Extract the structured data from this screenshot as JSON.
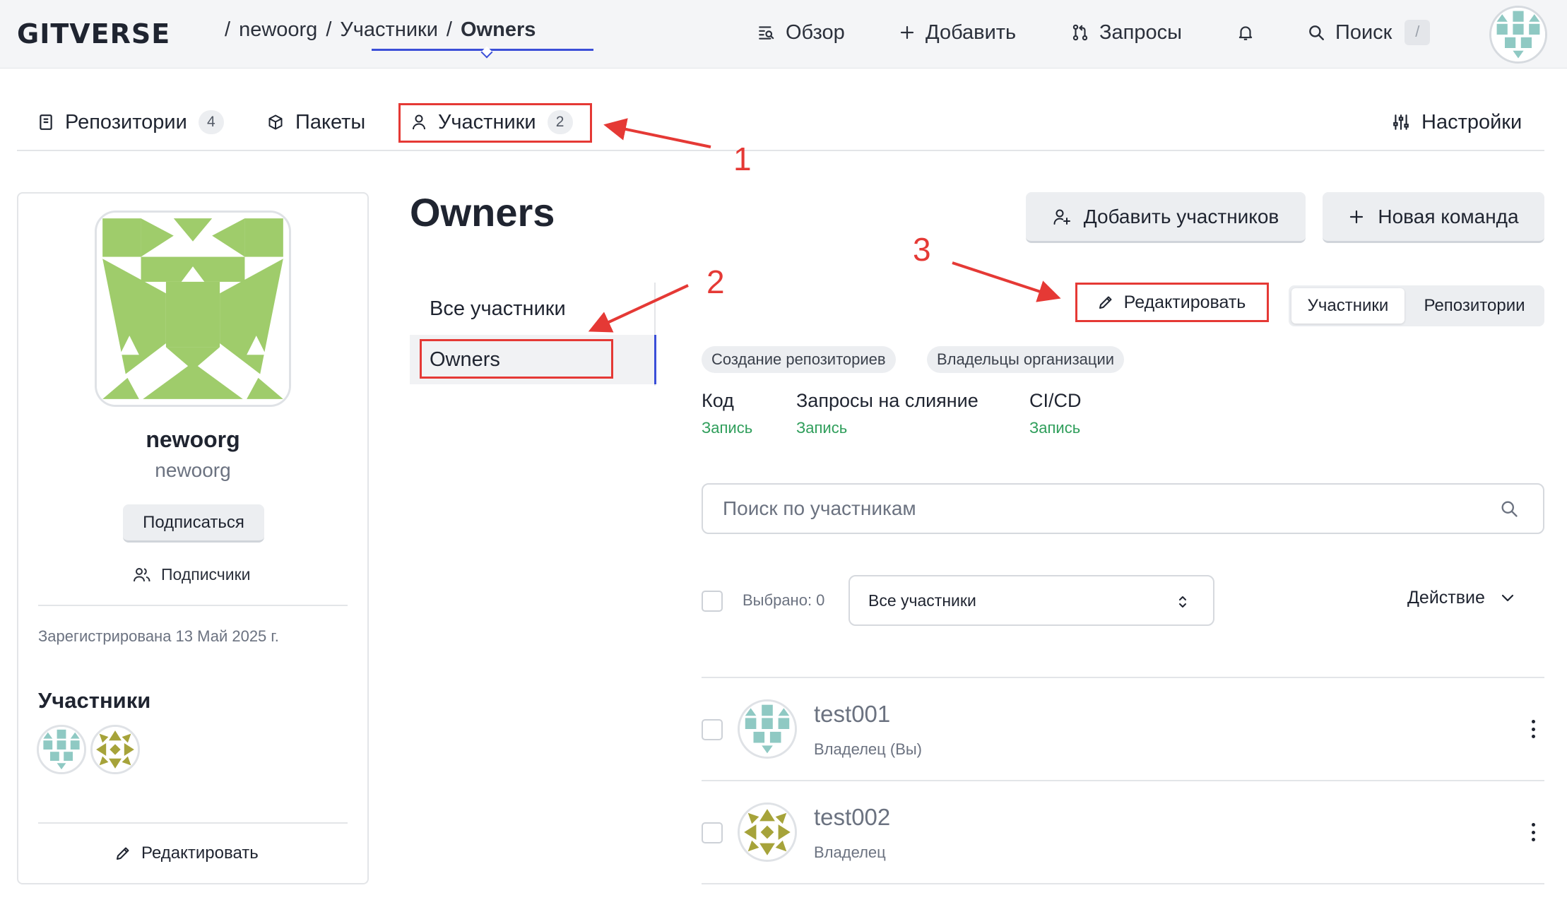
{
  "header": {
    "logo": "GITVERSE",
    "breadcrumbs": [
      "newoorg",
      "Участники",
      "Owners"
    ],
    "nav": {
      "overview": "Обзор",
      "add": "Добавить",
      "requests": "Запросы",
      "search": "Поиск",
      "search_shortcut": "/"
    }
  },
  "tabs": [
    {
      "label": "Репозитории",
      "count": "4"
    },
    {
      "label": "Пакеты"
    },
    {
      "label": "Участники",
      "count": "2"
    }
  ],
  "settings_label": "Настройки",
  "sidebar": {
    "org_name": "newoorg",
    "org_login": "newoorg",
    "follow_label": "Подписаться",
    "followers_label": "Подписчики",
    "registered": "Зарегистрирована 13 Май 2025 г.",
    "members_title": "Участники",
    "edit_label": "Редактировать"
  },
  "team": {
    "title": "Owners",
    "nav": [
      "Все участники",
      "Owners"
    ],
    "active_nav": "Owners",
    "add_members_label": "Добавить участников",
    "new_team_label": "Новая команда",
    "edit_label": "Редактировать",
    "view_toggle": [
      "Участники",
      "Репозитории"
    ],
    "chips": [
      "Создание репозиториев",
      "Владельцы организации"
    ],
    "permissions": [
      {
        "label": "Код",
        "value": "Запись"
      },
      {
        "label": "Запросы на слияние",
        "value": "Запись"
      },
      {
        "label": "CI/CD",
        "value": "Запись"
      }
    ],
    "search_placeholder": "Поиск по участникам",
    "selected_label": "Выбрано: 0",
    "filter_value": "Все участники",
    "action_label": "Действие",
    "members": [
      {
        "name": "test001",
        "role": "Владелец (Вы)"
      },
      {
        "name": "test002",
        "role": "Владелец"
      }
    ]
  },
  "annotations": [
    "1",
    "2",
    "3"
  ],
  "colors": {
    "accent": "#3b4fd8",
    "annotation": "#e53935",
    "permission_value": "#2f9e5b",
    "org_avatar": "#9fcc6b",
    "avatar_teal": "#8fc9c3",
    "avatar_olive": "#a6a33a"
  }
}
